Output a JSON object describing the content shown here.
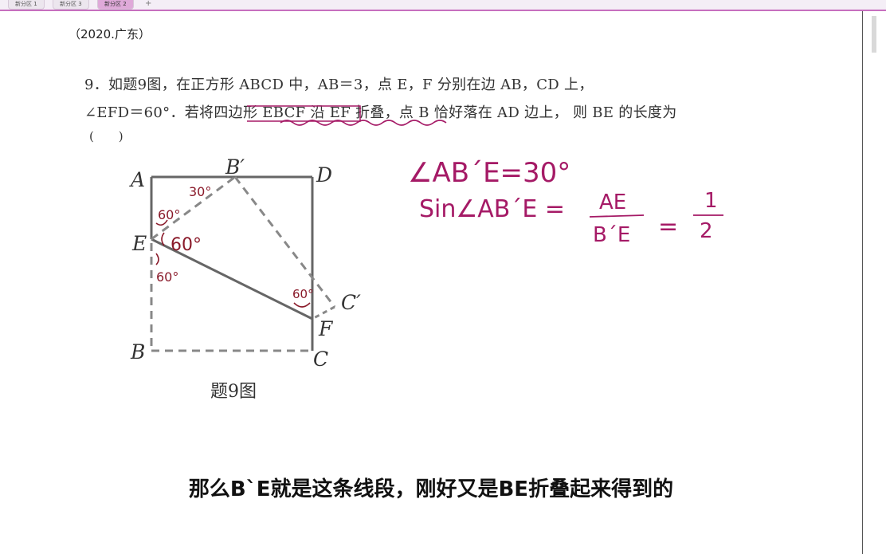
{
  "tabs": [
    {
      "label": "新分区 1",
      "active": false
    },
    {
      "label": "新分区 3",
      "active": false
    },
    {
      "label": "新分区 2",
      "active": true
    }
  ],
  "tab_add_label": "+",
  "source": "（2020.广东）",
  "question": {
    "line1": "9．如题9图，在正方形 ABCD 中，AB＝3，点 E，F 分别在边 AB，CD 上，",
    "line2": "∠EFD＝60°．若将四边形 EBCF 沿 EF 折叠，点 B 恰好落在 AD 边上， 则 BE 的长度为",
    "line3": "(　　)"
  },
  "figure": {
    "caption": "题9图",
    "vertices": {
      "A": "A",
      "B_prime": "B′",
      "D": "D",
      "E": "E",
      "C_prime": "C′",
      "F": "F",
      "B": "B",
      "C": "C"
    },
    "annotations": [
      "30°",
      "60°",
      "60°",
      "60°",
      "60°"
    ]
  },
  "handwriting": {
    "line1": "∠AB´E=30°",
    "line2_prefix": "Sin∠AB´E =",
    "frac_num": "AE",
    "frac_den": "B´E",
    "equals": "=",
    "half_num": "1",
    "half_den": "2"
  },
  "subtitle": "那么B`E就是这条线段，刚好又是BE折叠起来得到的",
  "colors": {
    "ink": "#8a1a2a",
    "accent": "#c76fbf",
    "figure": "#666666"
  }
}
